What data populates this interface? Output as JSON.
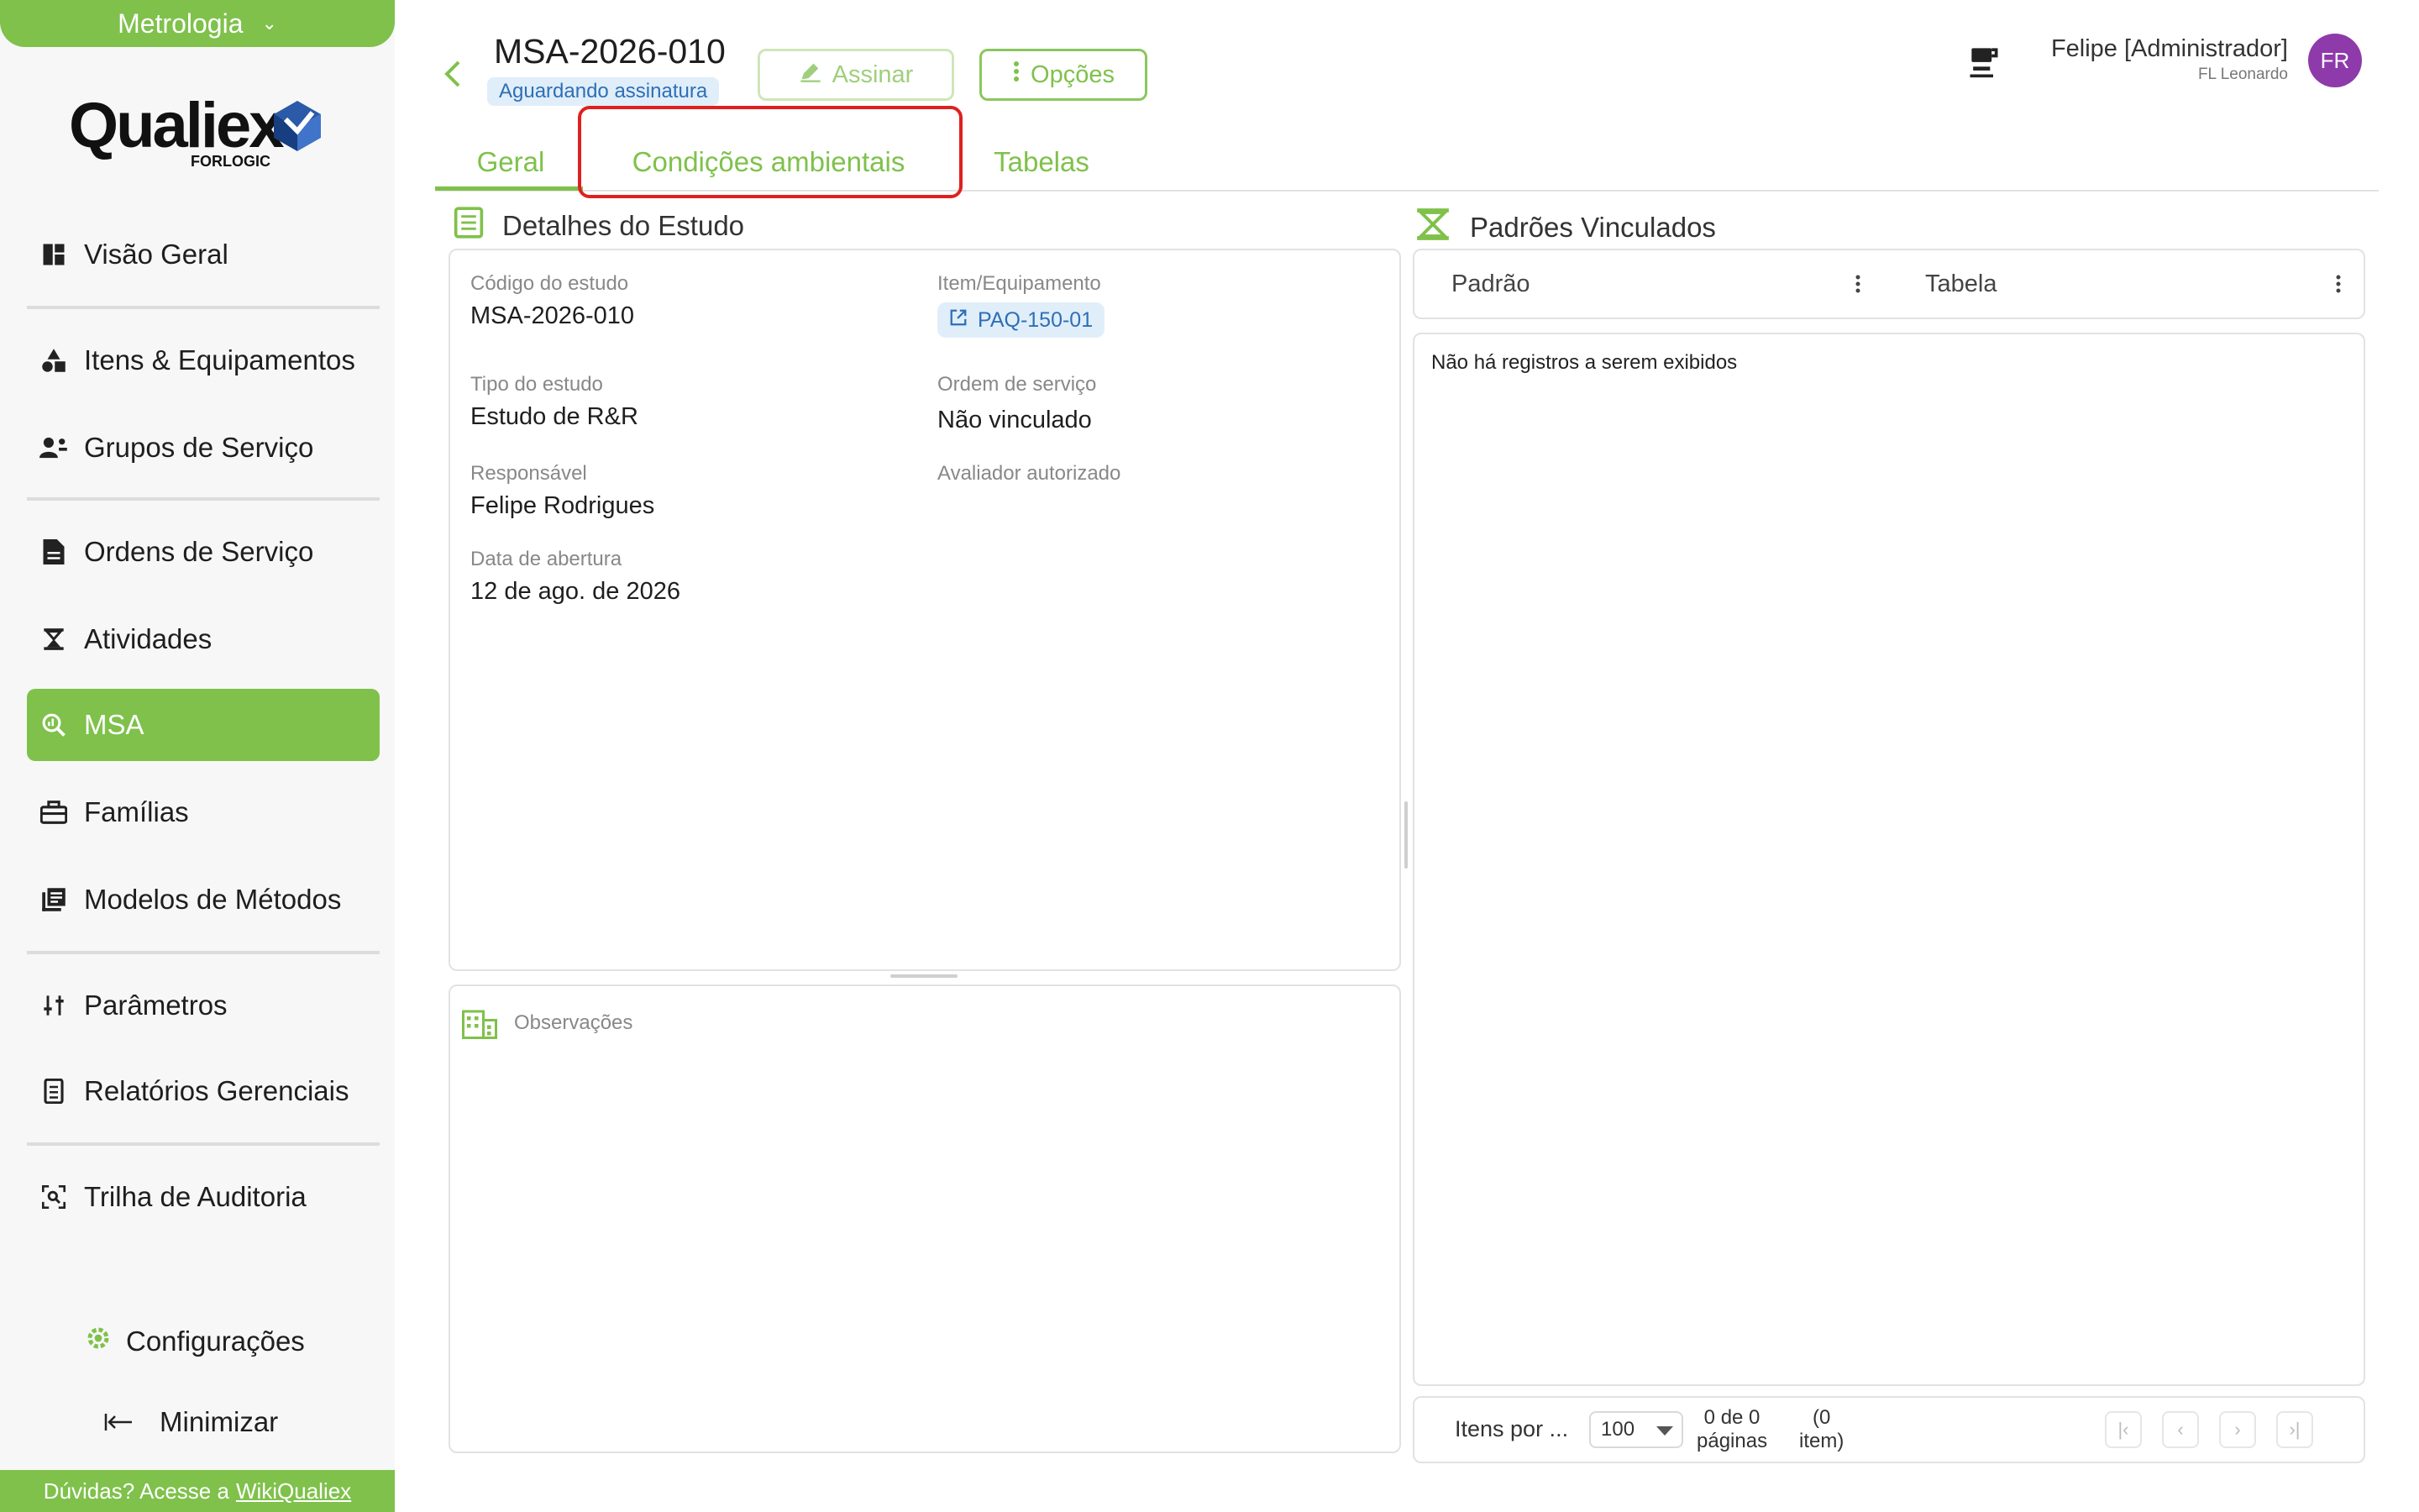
{
  "sidebar": {
    "module": "Metrologia",
    "logo_text": "Qualiex",
    "logo_sub": "FORLOGIC",
    "items": [
      {
        "label": "Visão Geral"
      },
      {
        "label": "Itens & Equipamentos"
      },
      {
        "label": "Grupos de Serviço"
      },
      {
        "label": "Ordens de Serviço"
      },
      {
        "label": "Atividades"
      },
      {
        "label": "MSA"
      },
      {
        "label": "Famílias"
      },
      {
        "label": "Modelos de Métodos"
      },
      {
        "label": "Parâmetros"
      },
      {
        "label": "Relatórios Gerenciais"
      },
      {
        "label": "Trilha de Auditoria"
      }
    ],
    "config_label": "Configurações",
    "minimize_label": "Minimizar",
    "help_text": "Dúvidas? Acesse a",
    "help_link": "WikiQualiex"
  },
  "header": {
    "title": "MSA-2026-010",
    "status": "Aguardando assinatura",
    "sign_label": "Assinar",
    "options_label": "Opções",
    "user_name": "Felipe [Administrador]",
    "user_company": "FL Leonardo",
    "avatar_initials": "FR"
  },
  "tabs": [
    {
      "label": "Geral"
    },
    {
      "label": "Condições ambientais"
    },
    {
      "label": "Tabelas"
    }
  ],
  "details": {
    "section_title": "Detalhes do Estudo",
    "fields": {
      "codigo_label": "Código do estudo",
      "codigo_value": "MSA-2026-010",
      "item_label": "Item/Equipamento",
      "item_value": "PAQ-150-01",
      "tipo_label": "Tipo do estudo",
      "tipo_value": "Estudo de R&R",
      "ordem_label": "Ordem de serviço",
      "ordem_value": "Não vinculado",
      "responsavel_label": "Responsável",
      "responsavel_value": "Felipe Rodrigues",
      "avaliador_label": "Avaliador autorizado",
      "data_label": "Data de abertura",
      "data_value": "12 de ago. de 2026"
    },
    "observacoes_label": "Observações"
  },
  "padroes": {
    "section_title": "Padrões Vinculados",
    "columns": [
      "Padrão",
      "Tabela"
    ],
    "empty_message": "Não há registros a serem exibidos",
    "pager": {
      "items_per_label": "Itens por ...",
      "items_per_value": "100",
      "count_line1": "0 de 0",
      "count_line2": "páginas",
      "count_paren1": "(0",
      "count_paren2": "item)"
    }
  },
  "colors": {
    "accent": "#7fc14b",
    "status_bg": "#e0eefa",
    "status_fg": "#2e6fb5",
    "highlight": "#e0201e",
    "avatar": "#8e3aaa"
  }
}
